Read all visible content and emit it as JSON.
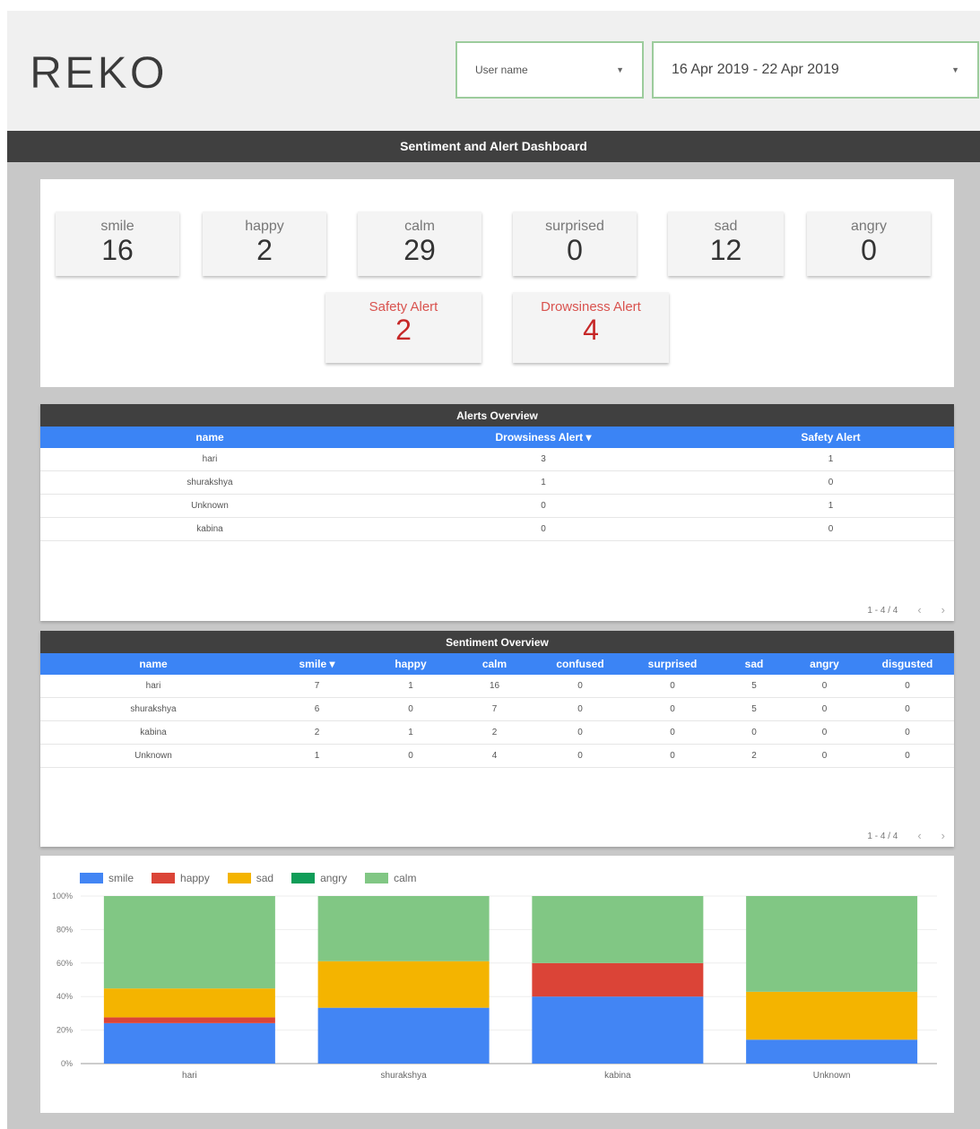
{
  "header": {
    "logo": "REKO",
    "user_select": {
      "value": "User name"
    },
    "date_select": {
      "value": "16 Apr 2019 - 22 Apr 2019"
    }
  },
  "title": "Sentiment and Alert Dashboard",
  "kpis": [
    {
      "label": "smile",
      "value": "16"
    },
    {
      "label": "happy",
      "value": "2"
    },
    {
      "label": "calm",
      "value": "29"
    },
    {
      "label": "surprised",
      "value": "0"
    },
    {
      "label": "sad",
      "value": "12"
    },
    {
      "label": "angry",
      "value": "0"
    }
  ],
  "alerts": [
    {
      "label": "Safety Alert",
      "value": "2"
    },
    {
      "label": "Drowsiness Alert",
      "value": "4"
    }
  ],
  "alerts_table": {
    "title": "Alerts Overview",
    "columns": [
      "name",
      "Drowsiness Alert ▾",
      "Safety Alert"
    ],
    "rows": [
      [
        "hari",
        "3",
        "1"
      ],
      [
        "shurakshya",
        "1",
        "0"
      ],
      [
        "Unknown",
        "0",
        "1"
      ],
      [
        "kabina",
        "0",
        "0"
      ]
    ],
    "pager": "1 - 4 / 4"
  },
  "sentiment_table": {
    "title": "Sentiment Overview",
    "columns": [
      "name",
      "smile ▾",
      "happy",
      "calm",
      "confused",
      "surprised",
      "sad",
      "angry",
      "disgusted"
    ],
    "rows": [
      [
        "hari",
        "7",
        "1",
        "16",
        "0",
        "0",
        "5",
        "0",
        "0"
      ],
      [
        "shurakshya",
        "6",
        "0",
        "7",
        "0",
        "0",
        "5",
        "0",
        "0"
      ],
      [
        "kabina",
        "2",
        "1",
        "2",
        "0",
        "0",
        "0",
        "0",
        "0"
      ],
      [
        "Unknown",
        "1",
        "0",
        "4",
        "0",
        "0",
        "2",
        "0",
        "0"
      ]
    ],
    "pager": "1 - 4 / 4"
  },
  "chart_data": {
    "type": "bar",
    "stacked": "percent",
    "categories": [
      "hari",
      "shurakshya",
      "kabina",
      "Unknown"
    ],
    "series": [
      {
        "name": "smile",
        "color": "#4285f4",
        "values": [
          7,
          6,
          2,
          1
        ]
      },
      {
        "name": "happy",
        "color": "#db4437",
        "values": [
          1,
          0,
          1,
          0
        ]
      },
      {
        "name": "sad",
        "color": "#f4b400",
        "values": [
          5,
          5,
          0,
          2
        ]
      },
      {
        "name": "angry",
        "color": "#0f9d58",
        "values": [
          0,
          0,
          0,
          0
        ]
      },
      {
        "name": "calm",
        "color": "#81c784",
        "values": [
          16,
          7,
          2,
          4
        ]
      }
    ],
    "y_ticks": [
      "0%",
      "20%",
      "40%",
      "60%",
      "80%",
      "100%"
    ],
    "ylim": [
      0,
      100
    ],
    "legend": "top-left",
    "grid": true
  }
}
